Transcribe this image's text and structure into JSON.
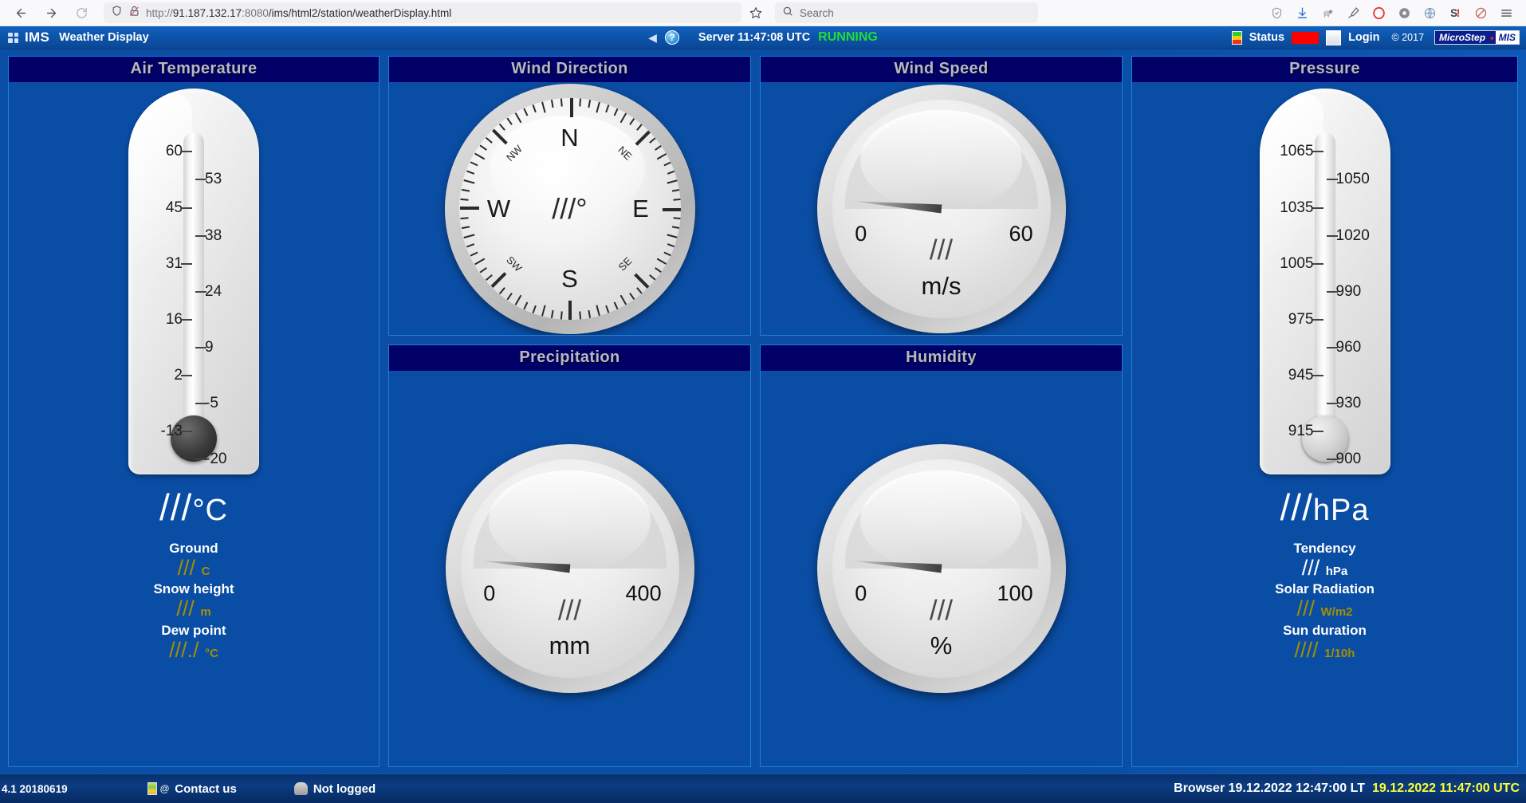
{
  "browser": {
    "back_icon": "back-arrow-icon",
    "forward_icon": "forward-arrow-icon",
    "reload_icon": "reload-icon",
    "shield_icon": "shield-icon",
    "lock_broken_icon": "broken-lock-icon",
    "url_scheme": "http://",
    "url_host": "91.187.132.17",
    "url_port": ":8080",
    "url_path": "/ims/html2/station/weatherDisplay.html",
    "bookmark_icon": "star-icon",
    "search_placeholder": "Search",
    "search_icon": "magnifier-icon",
    "extensions": [
      "shield-check-icon",
      "download-icon",
      "sheep-icon",
      "eyedropper-icon",
      "opera-o-icon",
      "gear-icon",
      "globe-lock-icon",
      "s-alert-icon",
      "blocked-icon",
      "hamburger-menu-icon"
    ]
  },
  "header": {
    "grid_icon": "app-grid-icon",
    "app_name": "IMS",
    "page_title": "Weather Display",
    "back_icon": "left-triangle-icon",
    "help_icon": "help-question-icon",
    "help_glyph": "?",
    "server_text": "Server 11:47:08 UTC",
    "server_state": "RUNNING",
    "status_icon": "traffic-light-icon",
    "status_label": "Status",
    "status_led_color": "#ff0000",
    "login_icon": "login-card-icon",
    "login_label": "Login",
    "copyright": "© 2017",
    "logo_left": "MicroStep",
    "logo_dot": "▪",
    "logo_right": "MIS"
  },
  "panels": {
    "air_temperature": {
      "title": "Air Temperature",
      "scale_left": [
        "60",
        "45",
        "31",
        "16",
        "2",
        "-13"
      ],
      "scale_right": [
        "53",
        "38",
        "24",
        "9",
        "-5",
        "-20"
      ],
      "value": "///",
      "unit": "°C",
      "sub": [
        {
          "label": "Ground",
          "value": "///",
          "unit": "C"
        },
        {
          "label": "Snow height",
          "value": "///",
          "unit": "m"
        },
        {
          "label": "Dew point",
          "value": "///./",
          "unit": "°C"
        }
      ]
    },
    "wind_direction": {
      "title": "Wind Direction",
      "value": "///°",
      "cardinals": [
        "N",
        "E",
        "S",
        "W"
      ],
      "intercardinals": [
        "NE",
        "SE",
        "SW",
        "NW"
      ]
    },
    "wind_speed": {
      "title": "Wind Speed",
      "min": "0",
      "max": "60",
      "value": "///",
      "unit": "m/s",
      "needle_angle_deg": 5
    },
    "precipitation": {
      "title": "Precipitation",
      "min": "0",
      "max": "400",
      "value": "///",
      "unit": "mm",
      "needle_angle_deg": 5
    },
    "humidity": {
      "title": "Humidity",
      "min": "0",
      "max": "100",
      "value": "///",
      "unit": "%",
      "needle_angle_deg": 5
    },
    "pressure": {
      "title": "Pressure",
      "scale_left": [
        "1065",
        "1035",
        "1005",
        "975",
        "945",
        "915"
      ],
      "scale_right": [
        "1050",
        "1020",
        "990",
        "960",
        "930",
        "900"
      ],
      "value": "///",
      "unit": "hPa",
      "sub": [
        {
          "label": "Tendency",
          "value": "///",
          "unit": "hPa",
          "color": "white"
        },
        {
          "label": "Solar Radiation",
          "value": "///",
          "unit": "W/m2",
          "color": "olive"
        },
        {
          "label": "Sun duration",
          "value": "////",
          "unit": "1/10h",
          "color": "olive"
        }
      ]
    }
  },
  "footer": {
    "version": "4.1 20180619",
    "mail_icon": "mail-icon",
    "contact_label": "Contact us",
    "user_icon": "user-icon",
    "login_status": "Not logged",
    "browser_time": "Browser 19.12.2022 12:47:00 LT",
    "utc_time": "19.12.2022 11:47:00 UTC"
  }
}
